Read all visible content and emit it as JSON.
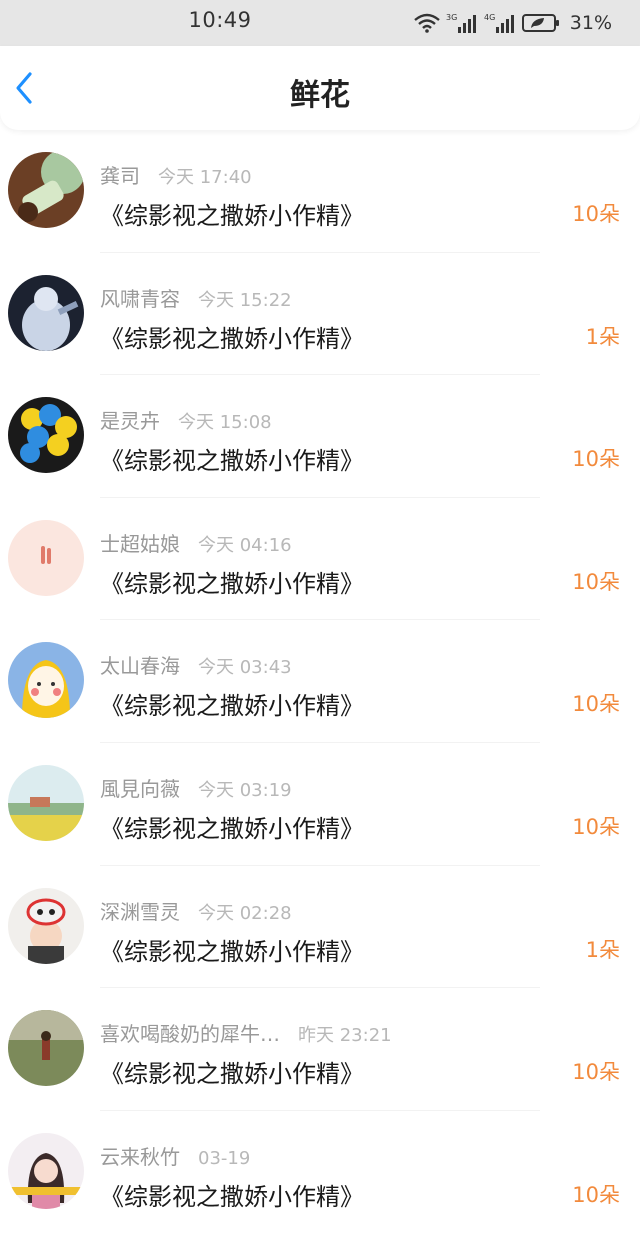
{
  "status_bar": {
    "time": "10:49",
    "battery": "31%",
    "icons": [
      "wifi-icon",
      "signal-3g-icon",
      "signal-4g-icon",
      "battery-icon"
    ]
  },
  "header": {
    "title": "鲜花",
    "back_icon": "chevron-left-icon",
    "accent_color": "#1e90ff"
  },
  "list": {
    "count_color": "#f28a3c",
    "items": [
      {
        "name": "龚司",
        "time": "今天 17:40",
        "book": "《综影视之撒娇小作精》",
        "count": "10朵"
      },
      {
        "name": "风啸青容",
        "time": "今天 15:22",
        "book": "《综影视之撒娇小作精》",
        "count": "1朵"
      },
      {
        "name": "是灵卉",
        "time": "今天 15:08",
        "book": "《综影视之撒娇小作精》",
        "count": "10朵"
      },
      {
        "name": "士超姑娘",
        "time": "今天 04:16",
        "book": "《综影视之撒娇小作精》",
        "count": "10朵"
      },
      {
        "name": "太山春海",
        "time": "今天 03:43",
        "book": "《综影视之撒娇小作精》",
        "count": "10朵"
      },
      {
        "name": "風見向薇",
        "time": "今天 03:19",
        "book": "《综影视之撒娇小作精》",
        "count": "10朵"
      },
      {
        "name": "深渊雪灵",
        "time": "今天 02:28",
        "book": "《综影视之撒娇小作精》",
        "count": "1朵"
      },
      {
        "name": "喜欢喝酸奶的犀牛…",
        "time": "昨天 23:21",
        "book": "《综影视之撒娇小作精》",
        "count": "10朵"
      },
      {
        "name": "云来秋竹",
        "time": "03-19",
        "book": "《综影视之撒娇小作精》",
        "count": "10朵"
      }
    ]
  }
}
